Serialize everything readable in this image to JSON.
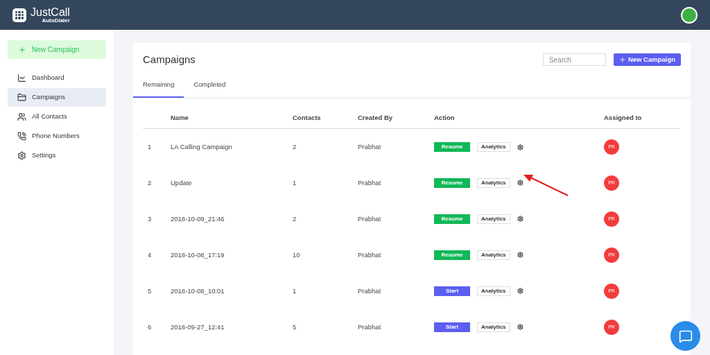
{
  "header": {
    "logo_name": "JustCall",
    "logo_sub": "AutoDialer"
  },
  "sidebar": {
    "new_button": "New Campaign",
    "items": [
      {
        "label": "Dashboard",
        "selected": false
      },
      {
        "label": "Campaigns",
        "selected": true
      },
      {
        "label": "All Contacts",
        "selected": false
      },
      {
        "label": "Phone Numbers",
        "selected": false
      },
      {
        "label": "Settings",
        "selected": false
      }
    ]
  },
  "page": {
    "title": "Campaigns",
    "search": {
      "placeholder": "Search"
    },
    "new_button": "New Campaign",
    "tabs": [
      {
        "label": "Remaining",
        "selected": true
      },
      {
        "label": "Completed",
        "selected": false
      }
    ]
  },
  "table": {
    "columns": [
      "",
      "Name",
      "Contacts",
      "Created By",
      "Action",
      "Assigned to"
    ],
    "rows": [
      {
        "index": "1",
        "name": "LA Calling Campaign",
        "contacts": "2",
        "created_by": "Prabhat",
        "action": {
          "label": "Resume",
          "kind": "resume"
        },
        "analytics": "Analytics",
        "assigned": "PR"
      },
      {
        "index": "2",
        "name": "Update",
        "contacts": "1",
        "created_by": "Prabhat",
        "action": {
          "label": "Resume",
          "kind": "resume"
        },
        "analytics": "Analytics",
        "assigned": "PR"
      },
      {
        "index": "3",
        "name": "2018-10-09_21:46",
        "contacts": "2",
        "created_by": "Prabhat",
        "action": {
          "label": "Resume",
          "kind": "resume"
        },
        "analytics": "Analytics",
        "assigned": "PR"
      },
      {
        "index": "4",
        "name": "2018-10-08_17:19",
        "contacts": "10",
        "created_by": "Prabhat",
        "action": {
          "label": "Resume",
          "kind": "resume"
        },
        "analytics": "Analytics",
        "assigned": "PR"
      },
      {
        "index": "5",
        "name": "2018-10-08_10:01",
        "contacts": "1",
        "created_by": "Prabhat",
        "action": {
          "label": "Start",
          "kind": "start"
        },
        "analytics": "Analytics",
        "assigned": "PR"
      },
      {
        "index": "6",
        "name": "2018-09-27_12:41",
        "contacts": "5",
        "created_by": "Prabhat",
        "action": {
          "label": "Start",
          "kind": "start"
        },
        "analytics": "Analytics",
        "assigned": "PR"
      }
    ]
  }
}
